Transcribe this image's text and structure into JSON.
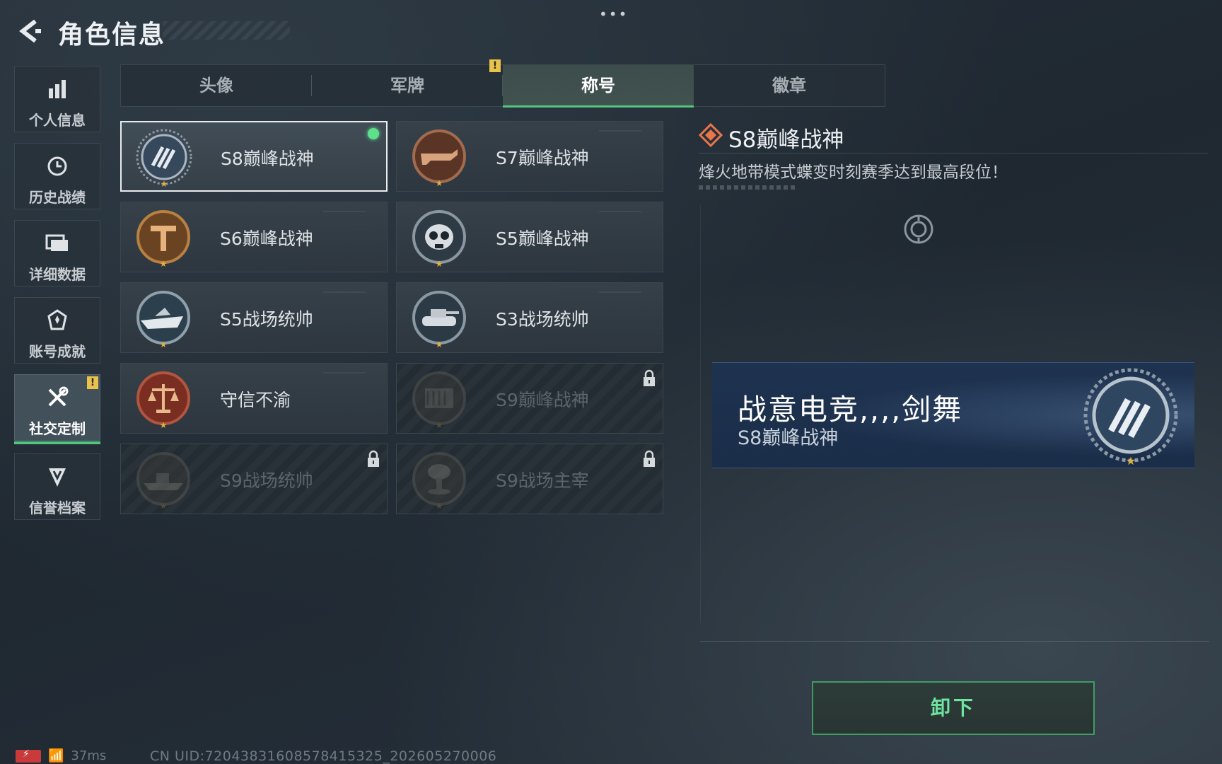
{
  "header": {
    "title": "角色信息",
    "menu_dots": "•••"
  },
  "sidebar": {
    "items": [
      {
        "label": "个人信息",
        "icon": "bar-chart-icon"
      },
      {
        "label": "历史战绩",
        "icon": "clock-icon"
      },
      {
        "label": "详细数据",
        "icon": "folder-icon"
      },
      {
        "label": "账号成就",
        "icon": "achievement-icon"
      },
      {
        "label": "社交定制",
        "icon": "tools-icon",
        "active": true,
        "warning": "!"
      },
      {
        "label": "信誉档案",
        "icon": "shield-icon"
      }
    ]
  },
  "tabs": [
    {
      "label": "头像"
    },
    {
      "label": "军牌",
      "warning": "!"
    },
    {
      "label": "称号",
      "active": true
    },
    {
      "label": "徽章"
    }
  ],
  "titles": [
    {
      "name": "S8巅峰战神",
      "emblem": "slash-emblem-icon",
      "selected": true,
      "equipped": true
    },
    {
      "name": "S7巅峰战神",
      "emblem": "rifle-emblem-icon"
    },
    {
      "name": "S6巅峰战神",
      "emblem": "t-emblem-icon"
    },
    {
      "name": "S5巅峰战神",
      "emblem": "skull-emblem-icon"
    },
    {
      "name": "S5战场统帅",
      "emblem": "boat-emblem-icon"
    },
    {
      "name": "S3战场统帅",
      "emblem": "tank-emblem-icon"
    },
    {
      "name": "守信不渝",
      "emblem": "scales-emblem-icon"
    },
    {
      "name": "S9巅峰战神",
      "emblem": "bunker-emblem-icon",
      "locked": true
    },
    {
      "name": "S9战场统帅",
      "emblem": "warship-emblem-icon",
      "locked": true
    },
    {
      "name": "S9战场主宰",
      "emblem": "mushroom-cloud-emblem-icon",
      "locked": true
    }
  ],
  "detail": {
    "title": "S8巅峰战神",
    "description": "烽火地带模式蝶变时刻赛季达到最高段位！",
    "banner": {
      "player_name": "战意电竞,,,,剑舞",
      "title": "S8巅峰战神"
    },
    "unequip_label": "卸下"
  },
  "status_bar": {
    "ping": "37ms",
    "uid": "CN UID:7204383160857841532​5_202605270006"
  },
  "colors": {
    "accent": "#4fc77f",
    "warning": "#e8c24a",
    "banner": "#1a2d49"
  }
}
